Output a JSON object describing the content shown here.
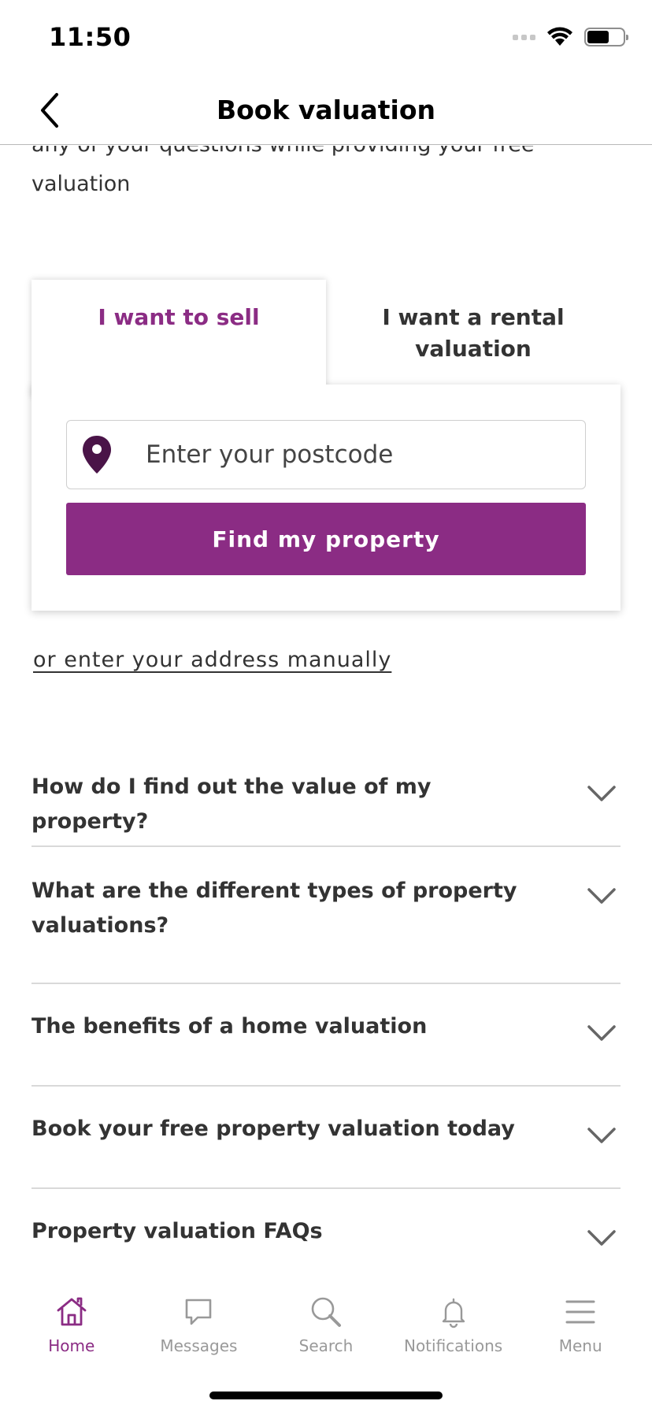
{
  "status_bar": {
    "time": "11:50",
    "icons": [
      "signal-icon",
      "wifi-icon",
      "battery-icon"
    ]
  },
  "nav": {
    "title": "Book valuation",
    "back_icon": "chevron-left-icon"
  },
  "intro": {
    "text": "any of your questions while providing your free valuation"
  },
  "tabs": {
    "sell_label": "I want to sell",
    "rental_label": "I want a rental valuation",
    "active": "sell"
  },
  "postcode": {
    "placeholder": "Enter your postcode",
    "value": "",
    "icon": "map-pin-icon"
  },
  "find_button": {
    "label": "Find my property"
  },
  "manual_link": {
    "label": "or enter your address manually"
  },
  "faqs": [
    {
      "label": "How do I find out the value of my property?"
    },
    {
      "label": "What are the different types of property valuations?"
    },
    {
      "label": "The benefits of a home valuation"
    },
    {
      "label": "Book your free property valuation today"
    },
    {
      "label": "Property valuation FAQs"
    }
  ],
  "tab_bar": {
    "items": [
      {
        "label": "Home",
        "icon": "home-icon",
        "active": true
      },
      {
        "label": "Messages",
        "icon": "chat-bubble-icon",
        "active": false
      },
      {
        "label": "Search",
        "icon": "search-icon",
        "active": false
      },
      {
        "label": "Notifications",
        "icon": "bell-icon",
        "active": false
      },
      {
        "label": "Menu",
        "icon": "hamburger-menu-icon",
        "active": false
      }
    ]
  },
  "colors": {
    "accent": "#8b2c84",
    "pin": "#4a1448",
    "text": "#333333",
    "inactive": "#999999"
  }
}
